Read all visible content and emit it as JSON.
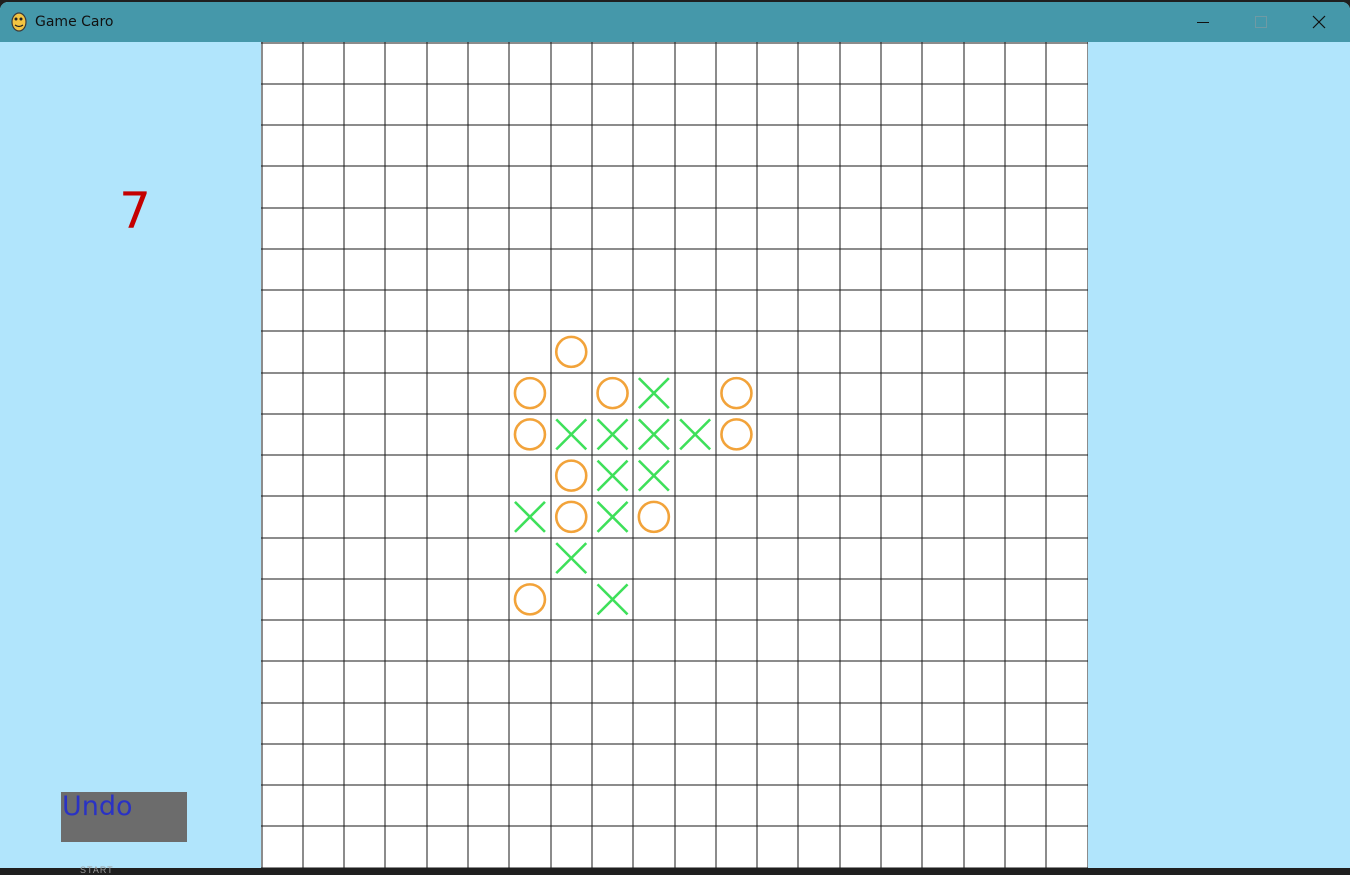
{
  "window": {
    "title": "Game Caro",
    "app_icon": "python-snake-icon"
  },
  "title_buttons": {
    "minimize": "minimize-icon",
    "maximize": "maximize-icon",
    "close": "close-icon"
  },
  "score": "7",
  "undo_label": "Undo",
  "start_label": "START",
  "colors": {
    "background": "#b1e5fc",
    "titlebar": "#4598aa",
    "board": "#ffffff",
    "grid_line": "#1a1a1a",
    "o_mark": "#f2a33a",
    "x_mark": "#3ee05a",
    "score": "#c40000",
    "undo_bg": "#6c6c6c",
    "undo_text": "#2a32c4"
  },
  "board": {
    "cols": 20,
    "rows": 20,
    "pieces": [
      {
        "row": 7,
        "col": 7,
        "mark": "O"
      },
      {
        "row": 8,
        "col": 6,
        "mark": "O"
      },
      {
        "row": 8,
        "col": 8,
        "mark": "O"
      },
      {
        "row": 8,
        "col": 9,
        "mark": "X"
      },
      {
        "row": 8,
        "col": 11,
        "mark": "O"
      },
      {
        "row": 9,
        "col": 6,
        "mark": "O"
      },
      {
        "row": 9,
        "col": 7,
        "mark": "X"
      },
      {
        "row": 9,
        "col": 8,
        "mark": "X"
      },
      {
        "row": 9,
        "col": 9,
        "mark": "X"
      },
      {
        "row": 9,
        "col": 10,
        "mark": "X"
      },
      {
        "row": 9,
        "col": 11,
        "mark": "O"
      },
      {
        "row": 10,
        "col": 7,
        "mark": "O"
      },
      {
        "row": 10,
        "col": 8,
        "mark": "X"
      },
      {
        "row": 10,
        "col": 9,
        "mark": "X"
      },
      {
        "row": 11,
        "col": 6,
        "mark": "X"
      },
      {
        "row": 11,
        "col": 7,
        "mark": "O"
      },
      {
        "row": 11,
        "col": 8,
        "mark": "X"
      },
      {
        "row": 11,
        "col": 9,
        "mark": "O"
      },
      {
        "row": 12,
        "col": 7,
        "mark": "X"
      },
      {
        "row": 13,
        "col": 6,
        "mark": "O"
      },
      {
        "row": 13,
        "col": 8,
        "mark": "X"
      }
    ]
  }
}
